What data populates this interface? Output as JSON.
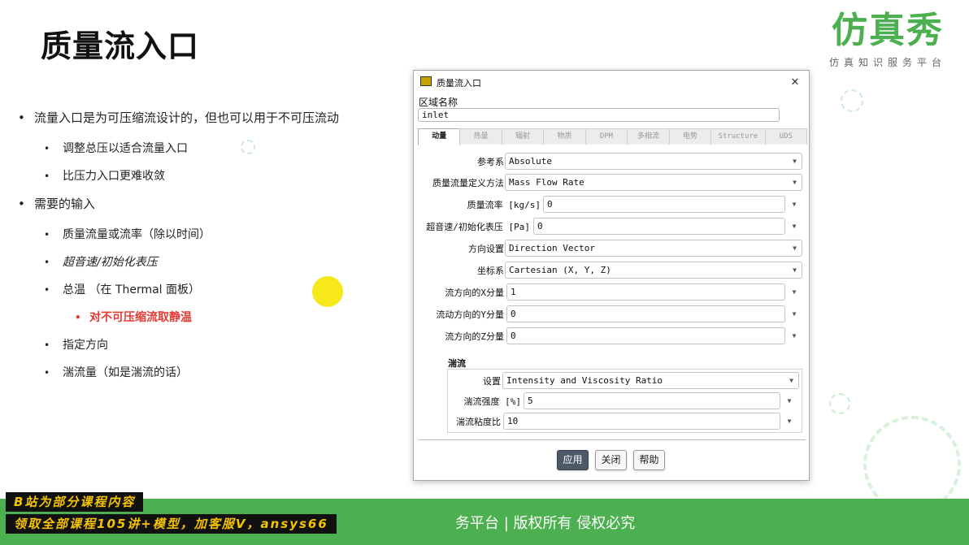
{
  "slide": {
    "title": "质量流入口",
    "logo": {
      "main": "仿真秀",
      "sub": "仿真知识服务平台"
    },
    "bullets": [
      {
        "level": 1,
        "text": "流量入口是为可压缩流设计的，但也可以用于不可压流动"
      },
      {
        "level": 2,
        "text": "调整总压以适合流量入口"
      },
      {
        "level": 2,
        "text": "比压力入口更难收敛"
      },
      {
        "level": 1,
        "text": "需要的输入"
      },
      {
        "level": 2,
        "text": "质量流量或流率（除以时间）"
      },
      {
        "level": 2,
        "text": "超音速/初始化表压",
        "italic": true
      },
      {
        "level": 2,
        "text": "总温 （在 Thermal 面板）"
      },
      {
        "level": 3,
        "text": "对不可压缩流取静温",
        "color": "#e53935"
      },
      {
        "level": 2,
        "text": "指定方向"
      },
      {
        "level": 2,
        "text": "湍流量（如是湍流的话）"
      }
    ]
  },
  "dialog": {
    "title": "质量流入口",
    "zone_name_label": "区域名称",
    "zone_name_value": "inlet",
    "tabs": [
      "动量",
      "热量",
      "辐射",
      "物质",
      "DPM",
      "多相流",
      "电势",
      "Structure",
      "UDS"
    ],
    "active_tab": "动量",
    "fields": {
      "reference_frame": {
        "label": "参考系",
        "value": "Absolute"
      },
      "mass_flow_spec": {
        "label": "质量流量定义方法",
        "value": "Mass Flow Rate"
      },
      "mass_flow_rate": {
        "label": "质量流率 [kg/s]",
        "value": "0"
      },
      "supersonic_pressure": {
        "label": "超音速/初始化表压 [Pa]",
        "value": "0"
      },
      "direction_spec": {
        "label": "方向设置",
        "value": "Direction Vector"
      },
      "coordinate_system": {
        "label": "坐标系",
        "value": "Cartesian (X, Y, Z)"
      },
      "x_component": {
        "label": "流方向的X分量",
        "value": "1"
      },
      "y_component": {
        "label": "流动方向的Y分量",
        "value": "0"
      },
      "z_component": {
        "label": "流方向的Z分量",
        "value": "0"
      }
    },
    "turbulence": {
      "title": "湍流",
      "method": {
        "label": "设置",
        "value": "Intensity and Viscosity Ratio"
      },
      "intensity": {
        "label": "湍流强度 [%]",
        "value": "5"
      },
      "viscosity_ratio": {
        "label": "湍流粘度比",
        "value": "10"
      }
    },
    "buttons": {
      "apply": "应用",
      "close": "关闭",
      "help": "帮助"
    }
  },
  "footer": {
    "text": "务平台 | 版权所有 侵权必究",
    "banner_line1": "B站为部分课程内容",
    "banner_line2": "领取全部课程105讲+模型，加客服V，ansys66"
  },
  "colors": {
    "accent_green": "#4caf50",
    "highlight_red": "#e53935",
    "banner_yellow": "#f5c400",
    "dot_yellow": "#f5e600"
  }
}
